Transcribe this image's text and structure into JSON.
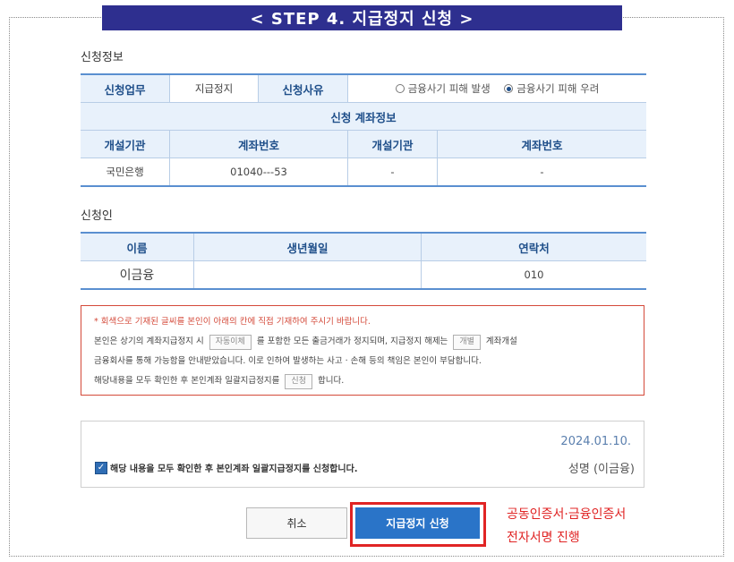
{
  "banner": "< STEP 4. 지급정지 신청 >",
  "sections": {
    "info": "신청정보",
    "applicant": "신청인"
  },
  "request": {
    "work_label": "신청업무",
    "work_value": "지급정지",
    "reason_label": "신청사유",
    "reason_options": [
      {
        "label": "금융사기 피해 발생",
        "selected": false
      },
      {
        "label": "금융사기 피해 우려",
        "selected": true
      }
    ],
    "account_section_title": "신청 계좌정보",
    "account_headers": [
      "개설기관",
      "계좌번호",
      "개설기관",
      "계좌번호"
    ],
    "account_row": [
      "국민은행",
      "01040---53",
      "-",
      "-"
    ]
  },
  "applicant": {
    "headers": [
      "이름",
      "생년월일",
      "연락처"
    ],
    "row": [
      "이금융",
      "",
      "010"
    ]
  },
  "notice": {
    "line1": "* 회색으로 기재된 글씨를 본인이 아래의 칸에 직접 기재하여 주시기 바랍니다.",
    "line2_a": "본인은 상기의 계좌지급정지 시",
    "line2_box1": "자동이체",
    "line2_b": "를 포함한 모든 출금거래가 정지되며, 지급정지 해제는",
    "line2_box2": "개별",
    "line2_c": "계좌개설",
    "line3": "금융회사를 통해 가능함을 안내받았습니다. 이로 인하여 발생하는 사고 · 손해 등의 책임은 본인이 부담합니다.",
    "line4_a": "해당내용을 모두 확인한 후 본인계좌 일괄지급정지를",
    "line4_box": "신청",
    "line4_b": "합니다."
  },
  "agreement": {
    "checked": true,
    "text": "해당 내용을 모두 확인한 후 본인계좌 일괄지급정지를 신청합니다.",
    "date": "2024.01.10.",
    "signature": "성명 (이금융)"
  },
  "buttons": {
    "cancel": "취소",
    "submit": "지급정지 신청"
  },
  "cert_note": {
    "line1": "공동인증서·금융인증서",
    "line2": "전자서명 진행"
  },
  "colors": {
    "banner": "#2e2f8f",
    "accent": "#2a74c8",
    "highlight": "#e02424"
  }
}
